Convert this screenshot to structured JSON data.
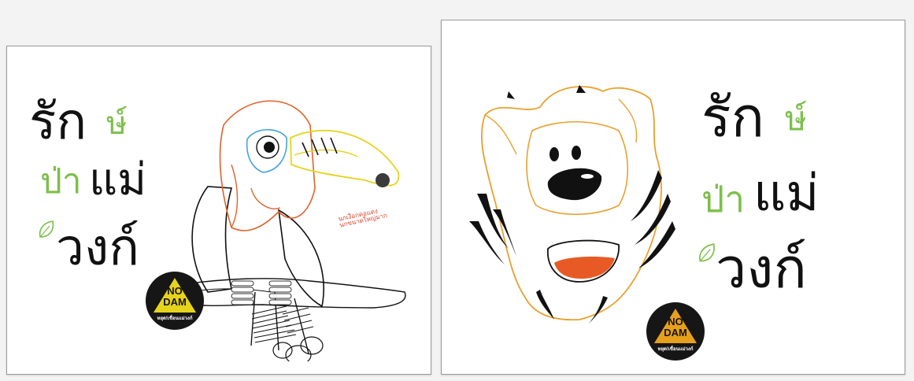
{
  "slogan": {
    "word1": "รัก",
    "word2": "ษ์",
    "word3": "ป่า",
    "word4": "แม่",
    "word5": "วงก์"
  },
  "hornbill_caption": {
    "line1": "นกเงือกคอแดง",
    "line2": "นกขนาดใหญ่มาก"
  },
  "badge": {
    "line1": "NO",
    "line2": "DAM",
    "line3": "หยุด!เขื่อนแม่วงก์"
  },
  "colors": {
    "text": "#111111",
    "accent_green": "#7cbf4a",
    "badge_bg": "#161616",
    "badge_triangle": "#e6d31c"
  },
  "icons": [
    "leaf-icon",
    "hornbill-illustration",
    "tiger-illustration",
    "warning-triangle-icon"
  ]
}
